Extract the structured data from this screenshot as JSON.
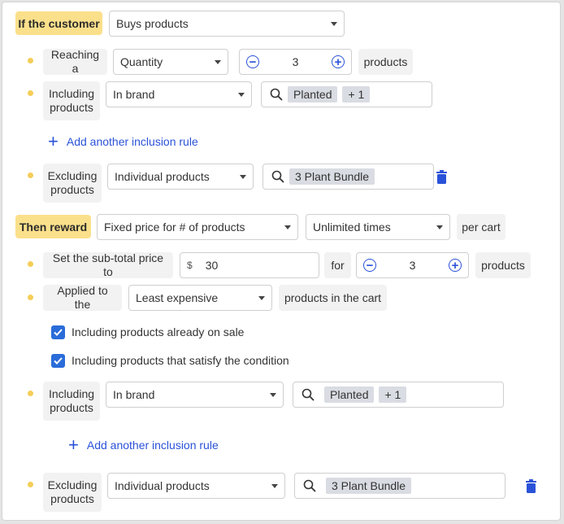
{
  "condition": {
    "label": "If the customer",
    "trigger_select": "Buys products",
    "reaching": {
      "label": "Reaching a",
      "select": "Quantity",
      "stepper_value": "3",
      "suffix": "products"
    },
    "including": {
      "label": "Including products",
      "select": "In brand",
      "tags": [
        "Planted",
        "+ 1"
      ]
    },
    "add_inclusion_link": "Add another inclusion rule",
    "excluding": {
      "label": "Excluding products",
      "select": "Individual products",
      "tags": [
        "3 Plant Bundle"
      ]
    }
  },
  "reward": {
    "label": "Then reward",
    "type_select": "Fixed price for # of products",
    "frequency_select": "Unlimited times",
    "per_cart_label": "per cart",
    "subtotal": {
      "label": "Set the sub-total price to",
      "currency_symbol": "$",
      "price_value": "30",
      "for_label": "for",
      "stepper_value": "3",
      "suffix": "products"
    },
    "applied": {
      "label": "Applied to the",
      "select": "Least expensive",
      "suffix": "products in the cart"
    },
    "checkboxes": [
      {
        "label": "Including products already on sale",
        "checked": true
      },
      {
        "label": "Including products that satisfy the condition",
        "checked": true
      }
    ],
    "including": {
      "label": "Including products",
      "select": "In brand",
      "tags": [
        "Planted",
        "+ 1"
      ]
    },
    "add_inclusion_link": "Add another inclusion rule",
    "excluding": {
      "label": "Excluding products",
      "select": "Individual products",
      "tags": [
        "3 Plant Bundle"
      ]
    }
  },
  "colors": {
    "accent": "#2a52d8",
    "highlight": "#fbe08b",
    "bullet": "#f5cd57"
  }
}
